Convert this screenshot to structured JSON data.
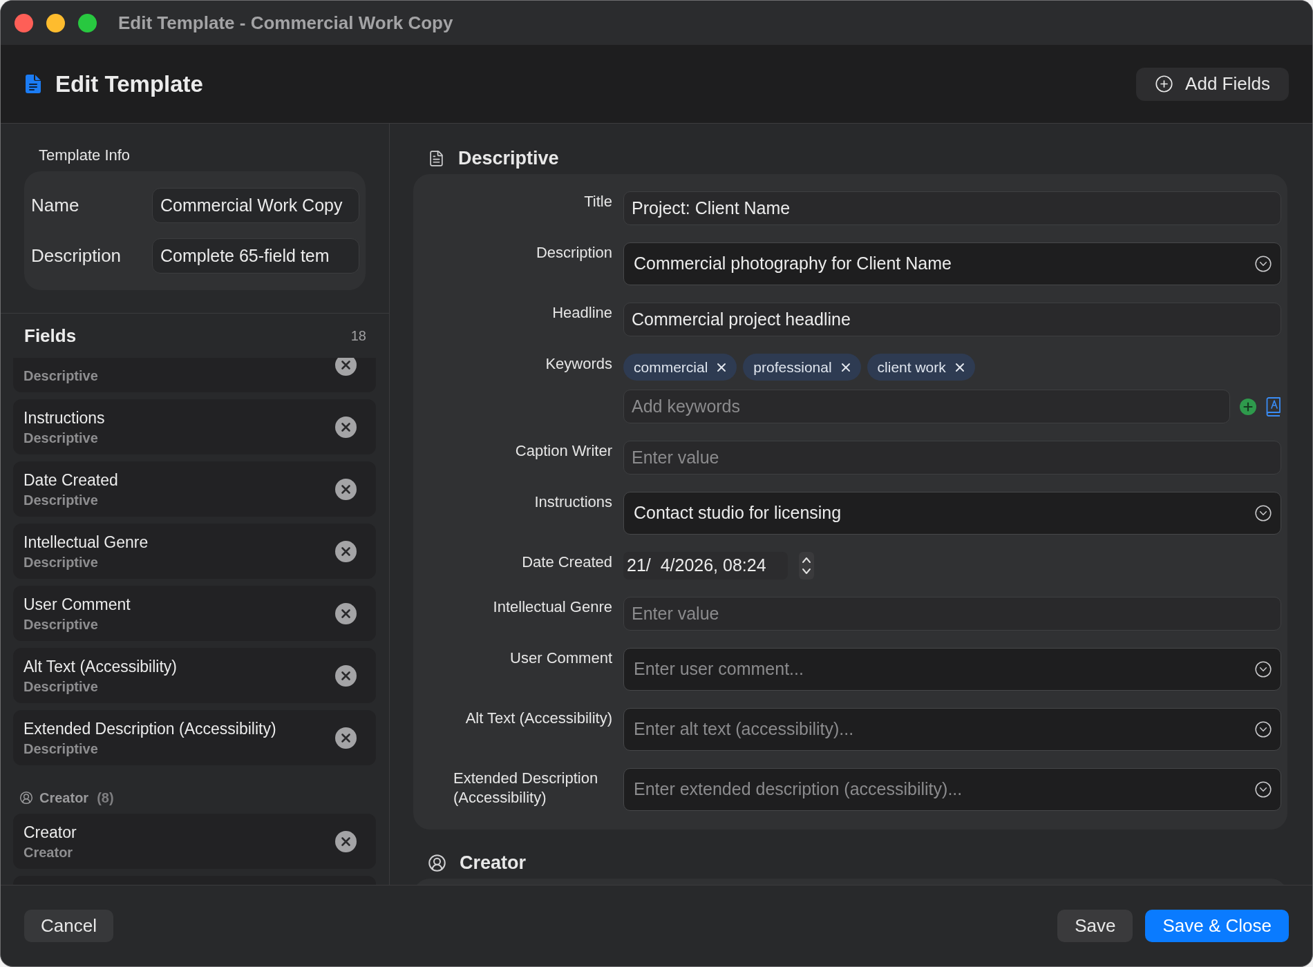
{
  "window": {
    "title": "Edit Template - Commercial Work Copy"
  },
  "header": {
    "title": "Edit Template",
    "add_button": "Add Fields"
  },
  "template_info": {
    "heading": "Template Info",
    "rows": [
      {
        "label": "Name",
        "value": "Commercial Work Copy"
      },
      {
        "label": "Description",
        "value": "Complete 65-field tem"
      }
    ]
  },
  "fields_panel": {
    "title": "Fields",
    "count": "18",
    "groups": [
      {
        "items": [
          {
            "category": "Descriptive"
          },
          {
            "name": "Instructions",
            "category": "Descriptive"
          },
          {
            "name": "Date Created",
            "category": "Descriptive"
          },
          {
            "name": "Intellectual Genre",
            "category": "Descriptive"
          },
          {
            "name": "User Comment",
            "category": "Descriptive"
          },
          {
            "name": "Alt Text (Accessibility)",
            "category": "Descriptive"
          },
          {
            "name": "Extended Description (Accessibility)",
            "category": "Descriptive"
          }
        ]
      },
      {
        "title": "Creator",
        "count": "(8)",
        "items": [
          {
            "name": "Creator",
            "category": "Creator"
          }
        ]
      }
    ]
  },
  "sections": [
    {
      "title": "Descriptive",
      "rows": [
        {
          "label": "Title",
          "kind": "text",
          "value": "Project: Client Name"
        },
        {
          "label": "Description",
          "kind": "multiline",
          "value": "Commercial photography for Client Name"
        },
        {
          "label": "Headline",
          "kind": "text",
          "value": "Commercial project headline"
        },
        {
          "label": "Keywords",
          "kind": "keywords",
          "keywords": [
            "commercial",
            "professional",
            "client work"
          ],
          "placeholder": "Add keywords"
        },
        {
          "label": "Caption Writer",
          "kind": "text",
          "placeholder": "Enter value"
        },
        {
          "label": "Instructions",
          "kind": "multiline",
          "value": "Contact studio for licensing"
        },
        {
          "label": "Date Created",
          "kind": "date",
          "value": "21/  4/2026, 08:24"
        },
        {
          "label": "Intellectual Genre",
          "kind": "text",
          "placeholder": "Enter value"
        },
        {
          "label": "User Comment",
          "kind": "multiline",
          "placeholder": "Enter user comment..."
        },
        {
          "label": "Alt Text (Accessibility)",
          "kind": "multiline",
          "placeholder": "Enter alt text (accessibility)..."
        },
        {
          "label": "Extended Description (Accessibility)",
          "kind": "multiline",
          "placeholder": "Enter extended description (accessibility)..."
        }
      ]
    },
    {
      "title": "Creator"
    }
  ],
  "footer": {
    "cancel": "Cancel",
    "save": "Save",
    "save_close": "Save & Close"
  }
}
